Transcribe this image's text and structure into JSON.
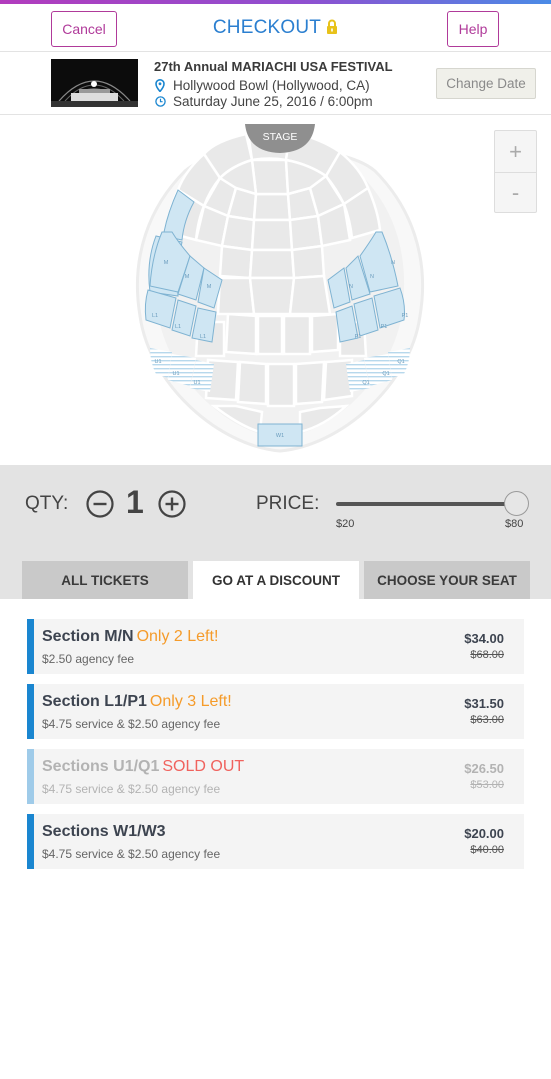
{
  "header": {
    "cancel_label": "Cancel",
    "title": "CHECKOUT",
    "help_label": "Help"
  },
  "event": {
    "title": "27th Annual MARIACHI USA FESTIVAL",
    "venue": "Hollywood Bowl (Hollywood, CA)",
    "date": "Saturday June 25, 2016 / 6:00pm",
    "change_date_label": "Change Date"
  },
  "map": {
    "stage_label": "STAGE",
    "zoom_in_label": "+",
    "zoom_out_label": "-",
    "section_labels": {
      "m": "M",
      "n": "N",
      "l1": "L1",
      "p1": "P1",
      "u1": "U1",
      "q1": "Q1",
      "w1": "W1"
    }
  },
  "controls": {
    "qty_label": "QTY:",
    "qty_value": "1",
    "price_label": "PRICE:",
    "price_min": "$20",
    "price_max": "$80",
    "price_selected_fraction": 1.0
  },
  "tabs": [
    {
      "label": "ALL TICKETS"
    },
    {
      "label": "GO AT A DISCOUNT"
    },
    {
      "label": "CHOOSE YOUR SEAT"
    }
  ],
  "listings": [
    {
      "section": "Section M/N",
      "tag": "Only 2 Left!",
      "fee": "$2.50 agency fee",
      "price": "$34.00",
      "original": "$68.00"
    },
    {
      "section": "Section L1/P1",
      "tag": "Only 3 Left!",
      "fee": "$4.75 service & $2.50 agency fee",
      "price": "$31.50",
      "original": "$63.00"
    },
    {
      "section": "Sections U1/Q1",
      "tag": "SOLD OUT",
      "fee": "$4.75 service & $2.50 agency fee",
      "price": "$26.50",
      "original": "$53.00"
    },
    {
      "section": "Sections W1/W3",
      "tag": "",
      "fee": "$4.75 service & $2.50 agency fee",
      "price": "$20.00",
      "original": "$40.00"
    }
  ],
  "colors": {
    "accent_magenta": "#b03a9a",
    "title_blue": "#2b7fd0",
    "listing_bar_blue": "#1a86d0",
    "low_stock_orange": "#f59b2a",
    "sold_out_red": "#f0625d",
    "highlight_section_fill": "#cfe6f3"
  }
}
